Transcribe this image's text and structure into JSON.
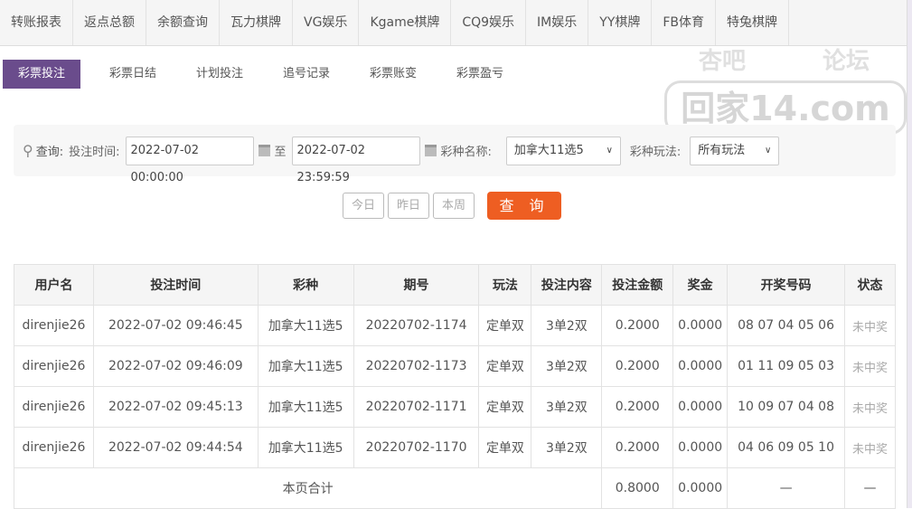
{
  "top_nav": [
    "转账报表",
    "返点总额",
    "余额查询",
    "瓦力棋牌",
    "VG娱乐",
    "Kgame棋牌",
    "CQ9娱乐",
    "IM娱乐",
    "YY棋牌",
    "FB体育",
    "特兔棋牌"
  ],
  "sub_tabs": [
    "彩票投注",
    "彩票日结",
    "计划投注",
    "追号记录",
    "彩票账变",
    "彩票盈亏"
  ],
  "active_sub_tab": "彩票投注",
  "watermark": {
    "top_left": "杏吧",
    "top_right": "论坛",
    "main": "回家14.com"
  },
  "filter": {
    "query_label": "查询:",
    "time_label": "投注时间:",
    "start": "2022-07-02 00:00:00",
    "to": "至",
    "end": "2022-07-02 23:59:59",
    "lottery_label": "彩种名称:",
    "lottery_value": "加拿大11选5",
    "play_label": "彩种玩法:",
    "play_value": "所有玩法"
  },
  "quick": [
    "今日",
    "昨日",
    "本周"
  ],
  "search_label": "查 询",
  "colors": {
    "accent": "#6a4c8c",
    "search_button": "#ee5e22"
  },
  "table": {
    "headers": [
      "用户名",
      "投注时间",
      "彩种",
      "期号",
      "玩法",
      "投注内容",
      "投注金额",
      "奖金",
      "开奖号码",
      "状态"
    ],
    "rows": [
      [
        "direnjie26",
        "2022-07-02 09:46:45",
        "加拿大11选5",
        "20220702-1174",
        "定单双",
        "3单2双",
        "0.2000",
        "0.0000",
        "08 07 04 05 06",
        "未中奖"
      ],
      [
        "direnjie26",
        "2022-07-02 09:46:09",
        "加拿大11选5",
        "20220702-1173",
        "定单双",
        "3单2双",
        "0.2000",
        "0.0000",
        "01 11 09 05 03",
        "未中奖"
      ],
      [
        "direnjie26",
        "2022-07-02 09:45:13",
        "加拿大11选5",
        "20220702-1171",
        "定单双",
        "3单2双",
        "0.2000",
        "0.0000",
        "10 09 07 04 08",
        "未中奖"
      ],
      [
        "direnjie26",
        "2022-07-02 09:44:54",
        "加拿大11选5",
        "20220702-1170",
        "定单双",
        "3单2双",
        "0.2000",
        "0.0000",
        "04 06 09 05 10",
        "未中奖"
      ]
    ],
    "total": {
      "label": "本页合计",
      "amount": "0.8000",
      "bonus": "0.0000",
      "numbers": "—",
      "status": "—"
    }
  }
}
